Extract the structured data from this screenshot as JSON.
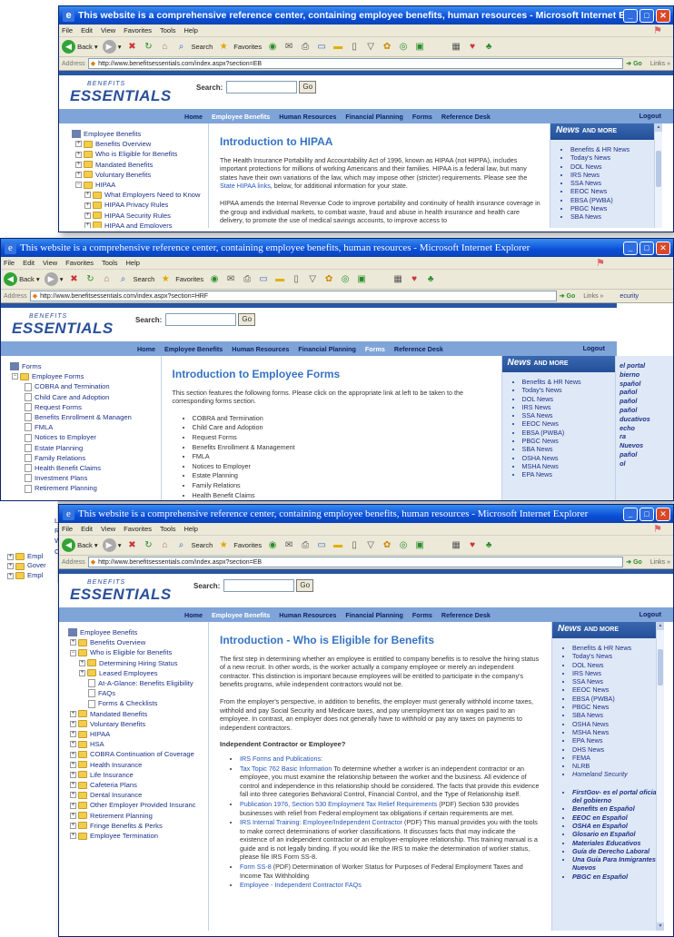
{
  "browser": {
    "title_w1": "This website is a comprehensive reference center, containing employee benefits, human resources - Microsoft Internet Explorer",
    "title_w2": "This website is a comprehensive reference center, containing employee benefits, human resources - Microsoft Internet Explorer",
    "title_w3": "This website is a comprehensive reference center, containing employee benefits, human resources - Microsoft Internet Explorer",
    "menu": [
      "File",
      "Edit",
      "View",
      "Favorites",
      "Tools",
      "Help"
    ],
    "back": "Back",
    "search": "Search",
    "favorites": "Favorites",
    "address_label": "Address",
    "go": "Go",
    "links": "Links",
    "url_w1": "http://www.benefitsessentials.com/index.aspx?section=EB",
    "url_w2": "http://www.benefitsessentials.com/index.aspx?section=HRF",
    "url_w3": "http://www.benefitsessentials.com/index.aspx?section=EB"
  },
  "site": {
    "logo_top": "BENEFITS",
    "logo_main": "ESSENTIALS",
    "search_label": "Search:",
    "search_button": "Go",
    "nav": [
      "Home",
      "Employee Benefits",
      "Human Resources",
      "Financial Planning",
      "Forms",
      "Reference Desk"
    ],
    "logout": "Logout",
    "news_title": "News",
    "news_sub": "AND MORE"
  },
  "w1": {
    "tree": [
      "Employee Benefits",
      "Benefits Overview",
      "Who is Eligible for Benefits",
      "Mandated Benefits",
      "Voluntary Benefits",
      "HIPAA",
      "What Employers Need to Know",
      "HIPAA Privacy Rules",
      "HIPAA Security Rules",
      "HIPAA and Employers"
    ],
    "heading": "Introduction to HIPAA",
    "p1a": "The Health Insurance Portability and Accountability Act of 1996, known as HIPAA (not HIPPA), includes important protections for millions of working Americans and their families. HIPAA is a federal law, but many states have their own variations of the law, which may impose other (stricter) requirements. Please see the ",
    "p1link": "State HIPAA links",
    "p1b": ", below, for additional information for your state.",
    "p2": "HIPAA amends the Internal Revenue Code to improve portability and continuity of health insurance coverage in the group and individual markets, to combat waste, fraud and abuse in health insurance and health care delivery, to promote the use of medical savings accounts, to improve access to",
    "news": [
      "Benefits & HR News",
      "Today's News",
      "DOL News",
      "IRS News",
      "SSA News",
      "EEOC News",
      "EBSA (PWBA)",
      "PBGC News",
      "SBA News"
    ]
  },
  "w2": {
    "tree": [
      "Forms",
      "Employee Forms",
      "COBRA and Termination",
      "Child Care and Adoption",
      "Request Forms",
      "Benefits Enrollment & Managen",
      "FMLA",
      "Notices to Employer",
      "Estate Planning",
      "Family Relations",
      "Health Benefit Claims",
      "Investment Plans",
      "Retirement Planning"
    ],
    "heading": "Introduction to Employee Forms",
    "p1": "This section features the following forms. Please click on the appropriate link at left to be taken to the corresponding forms section.",
    "list": [
      "COBRA and Termination",
      "Child Care and Adoption",
      "Request Forms",
      "Benefits Enrollment & Management",
      "FMLA",
      "Notices to Employer",
      "Estate Planning",
      "Family Relations",
      "Health Benefit Claims"
    ],
    "news": [
      "Benefits & HR News",
      "Today's News",
      "DOL News",
      "IRS News",
      "SSA News",
      "EEOC News",
      "EBSA (PWBA)",
      "PBGC News",
      "SBA News",
      "OSHA News",
      "MSHA News",
      "EPA News"
    ],
    "right_peek": [
      "el portal",
      "bierno",
      "spañol",
      "pañol",
      "pañol",
      "pañol",
      "ducativos",
      "echo",
      "ra",
      "Nuevos",
      "pañol",
      "ol"
    ],
    "security_peek": "ecurity",
    "left_peek": [
      "Li",
      "Re",
      "Wi",
      "Co",
      "Empl",
      "Gover",
      "Empl"
    ]
  },
  "w3": {
    "tree": [
      "Employee Benefits",
      "Benefits Overview",
      "Who is Eligible for Benefits",
      "Determining Hiring Status",
      "Leased Employees",
      "At-A-Glance: Benefits Eligibility",
      "FAQs",
      "Forms & Checklists",
      "Mandated Benefits",
      "Voluntary Benefits",
      "HIPAA",
      "HSA",
      "COBRA Continuation of Coverage",
      "Health Insurance",
      "Life Insurance",
      "Cafeteria Plans",
      "Dental Insurance",
      "Other Employer Provided Insuranc",
      "Retirement Planning",
      "Fringe Benefits & Perks",
      "Employee Termination"
    ],
    "heading": "Introduction - Who is Eligible for Benefits",
    "p1": "The first step in determining whether an employee is entitled to company benefits is to resolve the hiring status of a new recruit. In other words, is the worker actually a company employee or merely an independent contractor. This distinction is important because employees will be entitled to participate in the company's benefits programs, while independent contractors would not be.",
    "p2": "From the employer's perspective, in addition to benefits, the employer must generally withhold income taxes, withhold and pay Social Security and Medicare taxes, and pay unemployment tax on wages paid to an employee. In contrast, an employer does not generally have to withhold or pay any taxes on payments to independent contractors.",
    "subhead": "Independent Contractor or Employee?",
    "items": [
      {
        "link": "IRS Forms and Publications:",
        "text": ""
      },
      {
        "link": "Tax Topic 762 Basic Information",
        "text": " To determine whether a worker is an independent contractor or an employee, you must examine the relationship between the worker and the business. All evidence of control and independence in this relationship should be considered. The facts that provide this evidence fall into three categories Behavioral Control, Financial Control, and the Type of Relationship itself."
      },
      {
        "link": "Publication 1976, Section 530 Employment Tax Relief Requirements",
        "text": " (PDF) Section 530 provides businesses with relief from Federal employment tax obligations if certain requirements are met."
      },
      {
        "link": "IRS Internal Training: Employee/Independent Contractor",
        "text": " (PDF) This manual provides you with the tools to make correct determinations of worker classifications. It discusses facts that may indicate the existence of an independent contractor or an employer-employee relationship. This training manual is a guide and is not legally binding. If you would like the IRS to make the determination of worker status, please file IRS Form SS-8."
      },
      {
        "link": "Form SS-8",
        "text": " (PDF) Determination of Worker Status for Purposes of Federal Employment Taxes and Income Tax Withholding"
      },
      {
        "link": "Employee - Independent Contractor FAQs",
        "text": ""
      }
    ],
    "news": [
      "Benefits & HR News",
      "Today's News",
      "DOL News",
      "IRS News",
      "SSA News",
      "EEOC News",
      "EBSA (PWBA)",
      "PBGC News",
      "SBA News",
      "OSHA News",
      "MSHA News",
      "EPA News",
      "DHS News",
      "FEMA",
      "NLRB",
      "Homeland Security"
    ],
    "news2": [
      "FirstGov- es el portal oficial del gobierno",
      "Benefits en Español",
      "EEOC en Español",
      "OSHA en Español",
      "Glosario en Español",
      "Materiales Educativos",
      "Guía de Derecho Laboral",
      "Una Guía Para Inmigrantes Nuevos",
      "PBGC en Español"
    ]
  }
}
